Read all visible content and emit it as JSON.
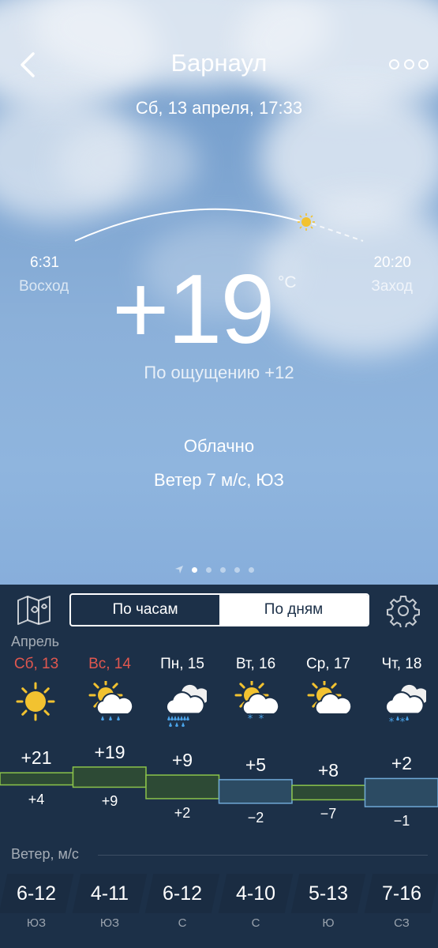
{
  "header": {
    "city": "Барнаул",
    "datetime": "Сб, 13 апреля, 17:33"
  },
  "sun": {
    "sunrise_time": "6:31",
    "sunrise_label": "Восход",
    "sunset_time": "20:20",
    "sunset_label": "Заход"
  },
  "current": {
    "temperature": "+19",
    "unit": "°C",
    "feels_like": "По ощущению +12",
    "condition": "Облачно",
    "wind": "Ветер 7 м/с, ЮЗ"
  },
  "pager": {
    "pages": 5,
    "active_index": 0
  },
  "tabs": {
    "hourly": "По часам",
    "daily": "По дням",
    "active": "daily"
  },
  "forecast": {
    "month": "Апрель",
    "wind_title": "Ветер, м/с",
    "days": [
      {
        "name": "Сб, 13",
        "weekend": true,
        "icon": "sunny-icon",
        "hi": "+21",
        "lo": "+4",
        "wind": "6-12",
        "dir": "ЮЗ"
      },
      {
        "name": "Вс, 14",
        "weekend": true,
        "icon": "partly-cloudy-rain-icon",
        "hi": "+19",
        "lo": "+9",
        "wind": "4-11",
        "dir": "ЮЗ"
      },
      {
        "name": "Пн, 15",
        "weekend": false,
        "icon": "cloudy-heavy-rain-icon",
        "hi": "+9",
        "lo": "+2",
        "wind": "6-12",
        "dir": "С"
      },
      {
        "name": "Вт, 16",
        "weekend": false,
        "icon": "partly-cloudy-snow-icon",
        "hi": "+5",
        "lo": "−2",
        "wind": "4-10",
        "dir": "С"
      },
      {
        "name": "Ср, 17",
        "weekend": false,
        "icon": "partly-cloudy-icon",
        "hi": "+8",
        "lo": "−7",
        "wind": "5-13",
        "dir": "Ю"
      },
      {
        "name": "Чт, 18",
        "weekend": false,
        "icon": "cloudy-snow-rain-icon",
        "hi": "+2",
        "lo": "−1",
        "wind": "7-16",
        "dir": "СЗ"
      }
    ]
  },
  "colors": {
    "panel": "#1c3048",
    "weekend": "#e0574f",
    "warm": "#8bc34a",
    "cold": "#6fa8d6",
    "sun": "#f2c230",
    "rain": "#4aa3e8"
  }
}
